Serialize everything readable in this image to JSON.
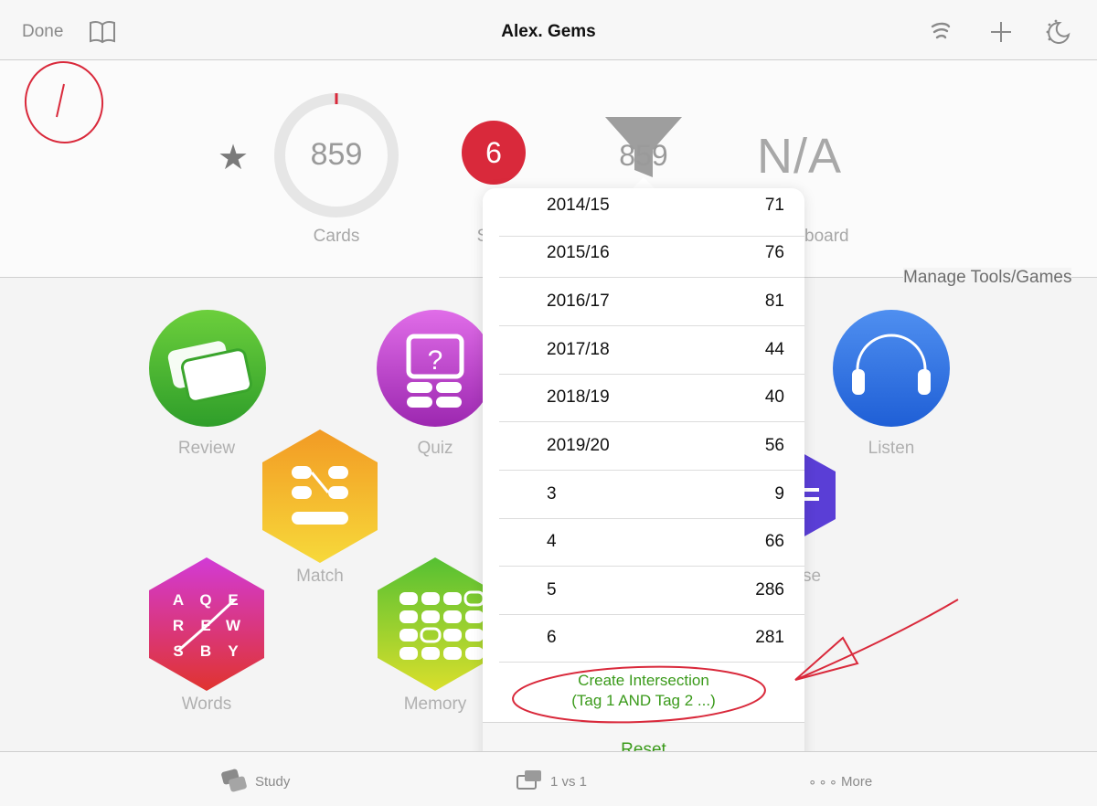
{
  "nav": {
    "done_label": "Done",
    "title": "Alex. Gems",
    "icons": [
      "book-icon",
      "wifi-icon",
      "plus-icon",
      "night-mode-icon"
    ]
  },
  "stats": {
    "cards_count": "859",
    "cards_label": "Cards",
    "badge_count": "6",
    "badge_label_partial": "S",
    "filtered_count": "859",
    "na_value": "N/A",
    "leaderboard_label_partial": "board",
    "accent_red": "#d9293b"
  },
  "manage_label": "Manage Tools/Games",
  "tools": [
    {
      "label": "Review",
      "icon": "review-cards-icon"
    },
    {
      "label": "Quiz",
      "icon": "quiz-icon"
    },
    {
      "label": "Listen",
      "icon": "headphones-icon"
    },
    {
      "label": "Match",
      "icon": "match-icon"
    },
    {
      "label": "se",
      "icon": "partial-tool-icon"
    },
    {
      "label": "Words",
      "icon": "words-icon"
    },
    {
      "label": "Memory",
      "icon": "memory-icon"
    }
  ],
  "popover": {
    "rows": [
      {
        "label": "2014/15",
        "count": "71"
      },
      {
        "label": "2015/16",
        "count": "76"
      },
      {
        "label": "2016/17",
        "count": "81"
      },
      {
        "label": "2017/18",
        "count": "44"
      },
      {
        "label": "2018/19",
        "count": "40"
      },
      {
        "label": "2019/20",
        "count": "56"
      },
      {
        "label": "3",
        "count": "9"
      },
      {
        "label": "4",
        "count": "66"
      },
      {
        "label": "5",
        "count": "286"
      },
      {
        "label": "6",
        "count": "281"
      }
    ],
    "create_line1": "Create Intersection",
    "create_line2": "(Tag 1 AND Tag 2 ...)",
    "reset_label": "Reset",
    "accent_green": "#3a9a1a"
  },
  "tabbar": {
    "study_label": "Study",
    "versus_label": "1 vs 1",
    "more_label": "More"
  }
}
